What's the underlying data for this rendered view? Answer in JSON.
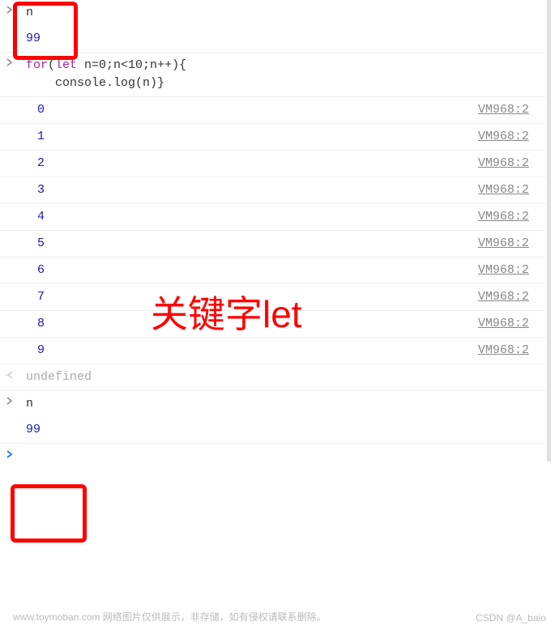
{
  "console": {
    "input1": "n",
    "result1": "99",
    "code_line1_prefix": "for",
    "code_line1_paren_open": "(",
    "code_line1_let": "let",
    "code_line1_rest": " n=0;n<10;n++){",
    "code_line2": "    console.log(n)}",
    "outputs": [
      {
        "val": "0",
        "src": "VM968:2"
      },
      {
        "val": "1",
        "src": "VM968:2"
      },
      {
        "val": "2",
        "src": "VM968:2"
      },
      {
        "val": "3",
        "src": "VM968:2"
      },
      {
        "val": "4",
        "src": "VM968:2"
      },
      {
        "val": "5",
        "src": "VM968:2"
      },
      {
        "val": "6",
        "src": "VM968:2"
      },
      {
        "val": "7",
        "src": "VM968:2"
      },
      {
        "val": "8",
        "src": "VM968:2"
      },
      {
        "val": "9",
        "src": "VM968:2"
      }
    ],
    "return_undef": "undefined",
    "input2": "n",
    "result2": "99"
  },
  "annotation": "关键字let",
  "watermark1": "www.toymoban.com 网络图片仅供展示，非存储，如有侵权请联系删除。",
  "watermark2": "CSDN @A_baio"
}
